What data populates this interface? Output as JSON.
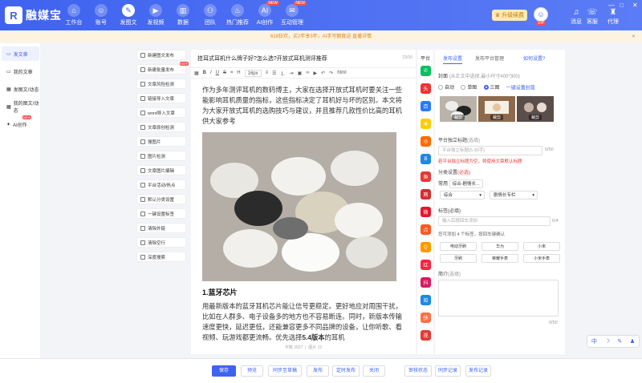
{
  "app": {
    "name": "融媒宝"
  },
  "nav": [
    {
      "label": "工作台",
      "icon": "home-icon",
      "glyph": "⌂"
    },
    {
      "label": "账号",
      "icon": "account-icon",
      "glyph": "☺"
    },
    {
      "label": "发图文",
      "icon": "publish-article-icon",
      "glyph": "✎",
      "active": true
    },
    {
      "label": "发视频",
      "icon": "video-icon",
      "glyph": "▶"
    },
    {
      "label": "数据",
      "icon": "chart-icon",
      "glyph": "▥"
    },
    {
      "label": "团队",
      "icon": "team-icon",
      "glyph": "⚇"
    },
    {
      "label": "热门推荐",
      "icon": "fire-icon",
      "glyph": "♨"
    },
    {
      "label": "AI创作",
      "icon": "ai-icon",
      "glyph": "AI",
      "badge": "NEW"
    },
    {
      "label": "互动管理",
      "icon": "chat-icon",
      "glyph": "✉",
      "badge": "NEW"
    }
  ],
  "header": {
    "upgrade_label": "升级续费",
    "vip": "VIP",
    "msg_label": "消息",
    "help_label": "客服",
    "agent_label": "代理",
    "download_label": "现金中心"
  },
  "notice": {
    "text": "618狂欢，买2年享3年，AI手写额度送 直播详情"
  },
  "sidebar": [
    {
      "label": "发文章",
      "icon": "document-icon",
      "glyph": "▭",
      "active": true
    },
    {
      "label": "我的文章",
      "icon": "my-article-icon",
      "glyph": "▭"
    },
    {
      "label": "发图文/动态",
      "icon": "image-text-icon",
      "glyph": "▦"
    },
    {
      "label": "我的图文/动态",
      "icon": "my-image-text-icon",
      "glyph": "▦"
    },
    {
      "label": "AI创作",
      "icon": "ai-write-icon",
      "glyph": "✦",
      "badge": "NEW"
    }
  ],
  "tools": [
    {
      "label": "新建图文发布"
    },
    {
      "label": "新建批量发布",
      "hot": "HOT"
    },
    {
      "label": "文章风险检测"
    },
    {
      "label": "链接导入文章"
    },
    {
      "label": "word导入文章"
    },
    {
      "label": "文章原创检测"
    },
    {
      "label": "搜图片"
    },
    {
      "label": "图片检测"
    },
    {
      "label": "文章图片编辑"
    },
    {
      "label": "平台活动/热点"
    },
    {
      "label": "默认分类设置"
    },
    {
      "label": "一键设置标签"
    },
    {
      "label": "清除外链"
    },
    {
      "label": "清除空行"
    },
    {
      "label": "深度搜索"
    }
  ],
  "editor": {
    "title": "挂耳式耳机什么牌子好?怎么选?开放式耳机测评推荐",
    "title_count": "23/30",
    "font_size": "16px",
    "toolbar_extra": "html",
    "para1": "作为多年测评耳机的数码博主，大家在选择开放式耳机时要关注一些能影响耳机质量的指标，这些指标决定了耳机好与坏的区别。本文将为大家开放式耳机的选购技巧与建议，并且推荐几款性价比高的耳机供大家参考",
    "heading": "1.蓝牙芯片",
    "para2a": "用最新版本的蓝牙耳机芯片能让信号更稳定。更好地应对周围干扰，比如在人群多、电子设备多的地方也不容易断连。同时，新版本传输速度更快，延迟更低，还能兼容更多不同品牌的设备，让你听歌、看视频、玩游戏都更流畅。优先选择",
    "para2b": "5.4版本",
    "para2c": "的耳机",
    "word_count": "字数 2027",
    "image_count": "图片 12"
  },
  "platforms_label": "平台",
  "platforms": [
    {
      "name": "wechat-icon",
      "color": "#07c160",
      "glyph": "✆"
    },
    {
      "name": "toutiao-icon",
      "color": "#e33",
      "glyph": "头"
    },
    {
      "name": "baijia-icon",
      "color": "#2979ff",
      "glyph": "百"
    },
    {
      "name": "zhihu-circle-icon",
      "color": "#ffcc00",
      "glyph": "◉"
    },
    {
      "name": "sohu-icon",
      "color": "#ff6a00",
      "glyph": "◎"
    },
    {
      "name": "b-icon",
      "color": "#1e88e5",
      "glyph": "B"
    },
    {
      "name": "dayu-icon",
      "color": "#e53935",
      "glyph": "鱼"
    },
    {
      "name": "wangyi-icon",
      "color": "#d32f2f",
      "glyph": "网"
    },
    {
      "name": "weibo-icon",
      "color": "#e6162d",
      "glyph": "微"
    },
    {
      "name": "yidian-icon",
      "color": "#ff5722",
      "glyph": "点"
    },
    {
      "name": "qq-icon",
      "color": "#ff9800",
      "glyph": "Q"
    },
    {
      "name": "xiaohongshu-icon",
      "color": "#ff2442",
      "glyph": "红"
    },
    {
      "name": "douyin-icon",
      "color": "#d81b60",
      "glyph": "抖"
    },
    {
      "name": "zhihu-icon",
      "color": "#1e88e5",
      "glyph": "知"
    },
    {
      "name": "kuaishou-icon",
      "color": "#ff7043",
      "glyph": "快"
    },
    {
      "name": "shipin-icon",
      "color": "#e53935",
      "glyph": "视"
    }
  ],
  "panel": {
    "tab_settings": "发布设置",
    "tab_manage": "发布平台管理",
    "tab_help": "如何设置?",
    "cover_label": "封面",
    "cover_hint": "(从正文中选择,最小尺寸400*300)",
    "radio_auto": "自动",
    "radio_single": "单图",
    "radio_triple": "三图",
    "one_key_cover": "一键设置封面",
    "cover_edit": "裁剪",
    "standalone_title_label": "平台独立标题",
    "standalone_title_optional": "(选填)",
    "title_placeholder": "平台独立标题(5-30字)",
    "title_count": "0/50",
    "warning": "若平台独立标题为空，将使用文章默认标题",
    "category_label": "分类设置",
    "category_required": "(必选)",
    "category_current_label": "常用",
    "category_current": "综合-剧情长...",
    "select1": "综合",
    "select2": "剧情长专栏",
    "tags_label": "标签(必填)",
    "tags_placeholder": "输入后按回车添加",
    "tags_count": "0/4",
    "tags_hint": "您可添加 4 个标签，按回车键确认",
    "tags": [
      "电动牙刷",
      "华为",
      "小米",
      "牙刷",
      "荣耀手表",
      "小米手表"
    ],
    "summary_label": "简介",
    "summary_optional": "(选填)",
    "summary_count": "0/50"
  },
  "bottom": {
    "save": "保存",
    "preview": "预览",
    "sync_draft": "同步至草稿",
    "publish": "发布",
    "schedule": "定时发布",
    "close": "关闭",
    "audit": "审核状态",
    "sync_record": "同步记录",
    "publish_record": "发布记录"
  },
  "tray": [
    "中",
    "☽",
    "✎",
    "♟"
  ]
}
